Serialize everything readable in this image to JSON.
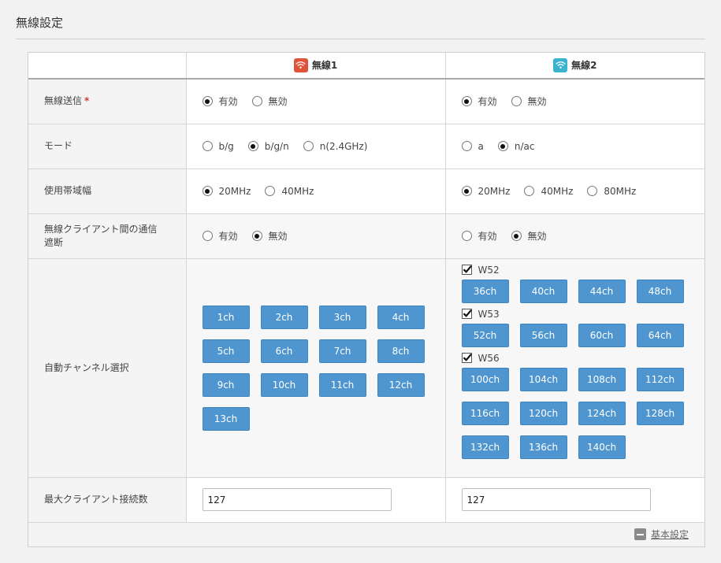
{
  "page": {
    "title": "無線設定"
  },
  "colors": {
    "wireless1_badge": "#e0533b",
    "wireless2_badge": "#3ab3cf",
    "channel_button": "#4f96d0"
  },
  "header": {
    "wireless1": {
      "label": "無線1",
      "icon": "wifi-icon"
    },
    "wireless2": {
      "label": "無線2",
      "icon": "wifi-icon"
    }
  },
  "rows": {
    "transmit": {
      "label": "無線送信",
      "required_mark": "*",
      "w1": {
        "options": [
          "有効",
          "無効"
        ],
        "selected": "有効"
      },
      "w2": {
        "options": [
          "有効",
          "無効"
        ],
        "selected": "有効"
      }
    },
    "mode": {
      "label": "モード",
      "w1": {
        "options": [
          "b/g",
          "b/g/n",
          "n(2.4GHz)"
        ],
        "selected": "b/g/n"
      },
      "w2": {
        "options": [
          "a",
          "n/ac"
        ],
        "selected": "n/ac"
      }
    },
    "bandwidth": {
      "label": "使用帯域幅",
      "w1": {
        "options": [
          "20MHz",
          "40MHz"
        ],
        "selected": "20MHz"
      },
      "w2": {
        "options": [
          "20MHz",
          "40MHz",
          "80MHz"
        ],
        "selected": "20MHz"
      }
    },
    "isolation": {
      "label_line1": "無線クライアント間の通信",
      "label_line2": "遮断",
      "w1": {
        "options": [
          "有効",
          "無効"
        ],
        "selected": "無効"
      },
      "w2": {
        "options": [
          "有効",
          "無効"
        ],
        "selected": "無効"
      }
    },
    "auto_channel": {
      "label": "自動チャンネル選択",
      "w1": {
        "channels": [
          "1ch",
          "2ch",
          "3ch",
          "4ch",
          "5ch",
          "6ch",
          "7ch",
          "8ch",
          "9ch",
          "10ch",
          "11ch",
          "12ch",
          "13ch"
        ]
      },
      "w2": {
        "groups": [
          {
            "name": "W52",
            "checked": true,
            "channels": [
              "36ch",
              "40ch",
              "44ch",
              "48ch"
            ]
          },
          {
            "name": "W53",
            "checked": true,
            "channels": [
              "52ch",
              "56ch",
              "60ch",
              "64ch"
            ]
          },
          {
            "name": "W56",
            "checked": true,
            "channels": [
              "100ch",
              "104ch",
              "108ch",
              "112ch",
              "116ch",
              "120ch",
              "124ch",
              "128ch",
              "132ch",
              "136ch",
              "140ch"
            ]
          }
        ]
      }
    },
    "max_clients": {
      "label": "最大クライアント接続数",
      "w1": {
        "value": "127"
      },
      "w2": {
        "value": "127"
      }
    }
  },
  "footer": {
    "link_label": "基本設定"
  }
}
